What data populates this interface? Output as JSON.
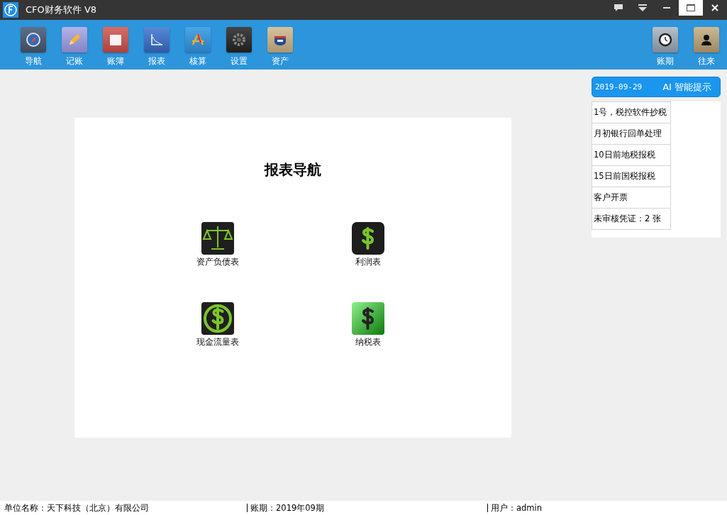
{
  "window": {
    "title": "CFO财务软件 V8"
  },
  "toolbar": {
    "left": [
      {
        "label": "导航"
      },
      {
        "label": "记账"
      },
      {
        "label": "账簿"
      },
      {
        "label": "报表"
      },
      {
        "label": "核算"
      },
      {
        "label": "设置"
      },
      {
        "label": "资产"
      }
    ],
    "right": [
      {
        "label": "账期"
      },
      {
        "label": "往来"
      }
    ]
  },
  "report_nav": {
    "title": "报表导航",
    "items": [
      {
        "label": "资产负债表"
      },
      {
        "label": "利润表"
      },
      {
        "label": "现金流量表"
      },
      {
        "label": "纳税表"
      }
    ]
  },
  "tips": {
    "date": "2019-09-29",
    "title": "AI 智能提示",
    "items": [
      "1号，税控软件抄税",
      "月初银行回单处理",
      "10日前地税报税",
      "15日前国税报税",
      "客户开票",
      "未审核凭证：2 张"
    ]
  },
  "status_bar": {
    "company": "单位名称：天下科技（北京）有限公司",
    "period": "账期：2019年09期",
    "user": "用户：admin"
  }
}
